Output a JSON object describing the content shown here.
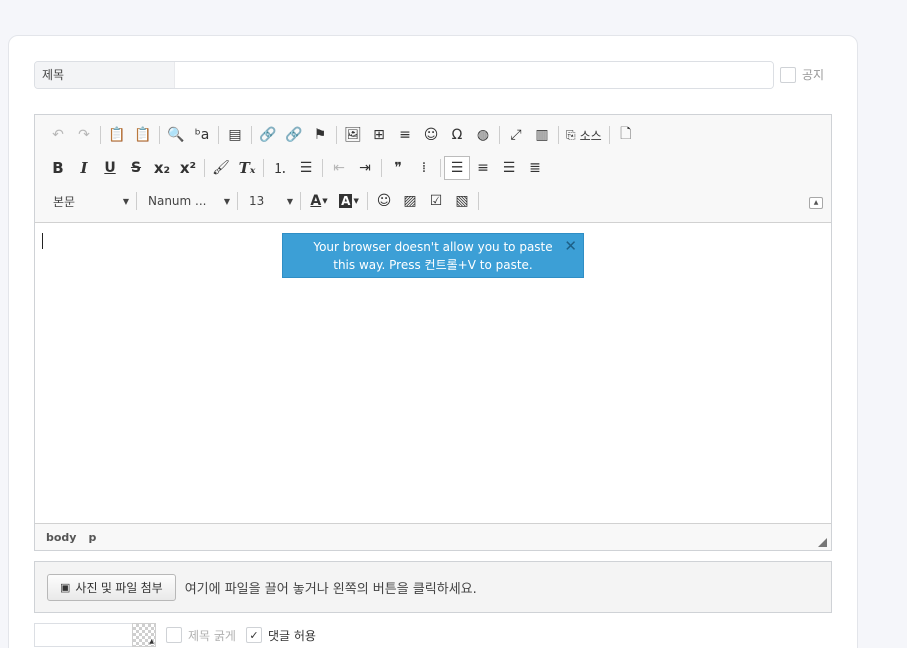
{
  "form": {
    "title_label": "제목",
    "title_value": "",
    "notice_label": "공지"
  },
  "toolbar": {
    "row1": [
      {
        "name": "undo-icon",
        "glyph": "↶",
        "disabled": true
      },
      {
        "name": "redo-icon",
        "glyph": "↷",
        "disabled": true
      },
      {
        "sep": true
      },
      {
        "name": "paste-text-icon",
        "glyph": "📋"
      },
      {
        "name": "paste-word-icon",
        "glyph": "📋"
      },
      {
        "sep": true
      },
      {
        "name": "find-icon",
        "glyph": "🔍"
      },
      {
        "name": "replace-icon",
        "glyph": "ᵇa"
      },
      {
        "sep": true
      },
      {
        "name": "select-all-icon",
        "glyph": "▤"
      },
      {
        "sep": true
      },
      {
        "name": "link-icon",
        "glyph": "🔗"
      },
      {
        "name": "unlink-icon",
        "glyph": "🔗",
        "disabled": true
      },
      {
        "name": "anchor-icon",
        "glyph": "⚑"
      },
      {
        "sep": true
      },
      {
        "name": "image-icon",
        "glyph": "🖼"
      },
      {
        "name": "table-icon",
        "glyph": "⊞"
      },
      {
        "name": "horizontal-rule-icon",
        "glyph": "≡"
      },
      {
        "name": "smiley-icon",
        "glyph": "☺"
      },
      {
        "name": "special-char-icon",
        "glyph": "Ω"
      },
      {
        "name": "iframe-icon",
        "glyph": "◍"
      },
      {
        "sep": true
      },
      {
        "name": "maximize-icon",
        "glyph": "⤢"
      },
      {
        "name": "show-blocks-icon",
        "glyph": "▥"
      },
      {
        "sep": true
      },
      {
        "name": "source-icon",
        "glyph": "⎘",
        "label": "소스"
      },
      {
        "sep": true
      },
      {
        "name": "new-page-icon",
        "glyph": "🗋"
      }
    ],
    "row2": [
      {
        "name": "bold-icon",
        "glyph": "B",
        "cls": "bold"
      },
      {
        "name": "italic-icon",
        "glyph": "I",
        "cls": "ital"
      },
      {
        "name": "underline-icon",
        "glyph": "U",
        "cls": "und"
      },
      {
        "name": "strike-icon",
        "glyph": "S",
        "cls": "strike"
      },
      {
        "name": "subscript-icon",
        "glyph": "x₂",
        "cls": "bold"
      },
      {
        "name": "superscript-icon",
        "glyph": "x²",
        "cls": "bold"
      },
      {
        "sep": true
      },
      {
        "name": "copy-format-icon",
        "glyph": "🖌"
      },
      {
        "name": "remove-format-icon",
        "glyph": "Tₓ",
        "cls": "ital"
      },
      {
        "sep": true
      },
      {
        "name": "numbered-list-icon",
        "glyph": "⒈"
      },
      {
        "name": "bulleted-list-icon",
        "glyph": "☰"
      },
      {
        "sep": true
      },
      {
        "name": "outdent-icon",
        "glyph": "⇤",
        "disabled": true
      },
      {
        "name": "indent-icon",
        "glyph": "⇥"
      },
      {
        "sep": true
      },
      {
        "name": "blockquote-icon",
        "glyph": "❞"
      },
      {
        "name": "div-container-icon",
        "glyph": "⁞"
      },
      {
        "sep": true
      },
      {
        "name": "align-left-icon",
        "glyph": "☰",
        "active": true
      },
      {
        "name": "align-center-icon",
        "glyph": "≡"
      },
      {
        "name": "align-right-icon",
        "glyph": "☰"
      },
      {
        "name": "align-justify-icon",
        "glyph": "≣"
      }
    ],
    "format_combo": "본문",
    "font_combo": "Nanum ...",
    "size_combo": "13",
    "text_color_glyph": "A",
    "bg_color_glyph": "A",
    "row3_icons": [
      {
        "name": "emoji-icon",
        "glyph": "☺"
      },
      {
        "name": "image-gallery-icon",
        "glyph": "▨"
      },
      {
        "name": "checkbox-icon",
        "glyph": "☑"
      },
      {
        "name": "image-upload-icon",
        "glyph": "▧"
      }
    ]
  },
  "paste_notice": {
    "text": "Your browser doesn't allow you to paste this way. Press 컨트롤+V to paste."
  },
  "pathbar": {
    "items": [
      "body",
      "p"
    ]
  },
  "upload": {
    "button_label": "사진 및 파일 첨부",
    "hint": "여기에 파일을 끌어 놓거나 왼쪽의 버튼을 클릭하세요."
  },
  "options": {
    "bold_title_label": "제목 굵게",
    "allow_comments_label": "댓글 허용",
    "allow_comments_checked": "✓"
  }
}
